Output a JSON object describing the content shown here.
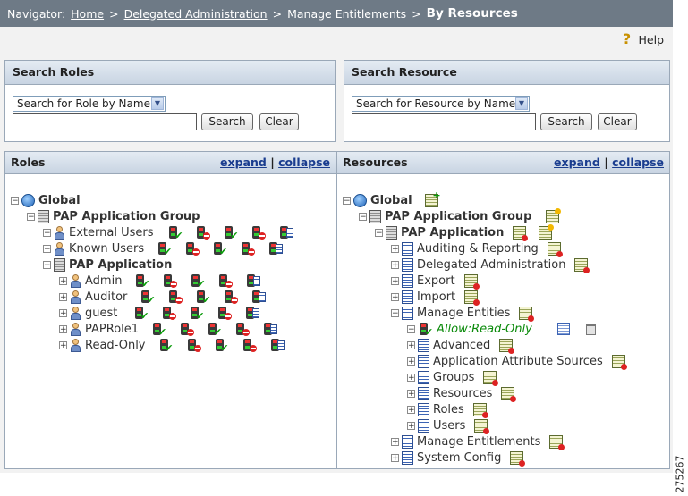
{
  "navigator": {
    "label": "Navigator:",
    "crumbs": [
      "Home",
      "Delegated Administration",
      "Manage Entitlements"
    ],
    "current": "By Resources"
  },
  "help": {
    "label": "Help",
    "icon": "question-icon"
  },
  "search_roles": {
    "title": "Search Roles",
    "select_value": "Search for Role by Name",
    "input_value": "",
    "search_button": "Search",
    "clear_button": "Clear"
  },
  "search_resource": {
    "title": "Search Resource",
    "select_value": "Search for Resource by Name",
    "input_value": "",
    "search_button": "Search",
    "clear_button": "Clear"
  },
  "roles_panel": {
    "title": "Roles",
    "expand": "expand",
    "separator": "|",
    "collapse": "collapse",
    "tree": {
      "global": "Global",
      "group": "PAP Application Group",
      "external_users": "External Users",
      "known_users": "Known Users",
      "application": "PAP Application",
      "admin": "Admin",
      "auditor": "Auditor",
      "guest": "guest",
      "paprole1": "PAPRole1",
      "readonly": "Read-Only"
    }
  },
  "resources_panel": {
    "title": "Resources",
    "expand": "expand",
    "separator": "|",
    "collapse": "collapse",
    "tree": {
      "global": "Global",
      "group": "PAP Application Group",
      "application": "PAP Application",
      "auditing": "Auditing & Reporting",
      "delegated": "Delegated Administration",
      "export": "Export",
      "import": "Import",
      "manage_entities": "Manage Entities",
      "allow_readonly": "Allow:Read-Only",
      "advanced": "Advanced",
      "app_attr_sources": "Application Attribute Sources",
      "groups": "Groups",
      "resources": "Resources",
      "roles": "Roles",
      "users": "Users",
      "manage_entitlements": "Manage Entitlements",
      "system_config": "System Config"
    }
  },
  "figure_number": "275267"
}
